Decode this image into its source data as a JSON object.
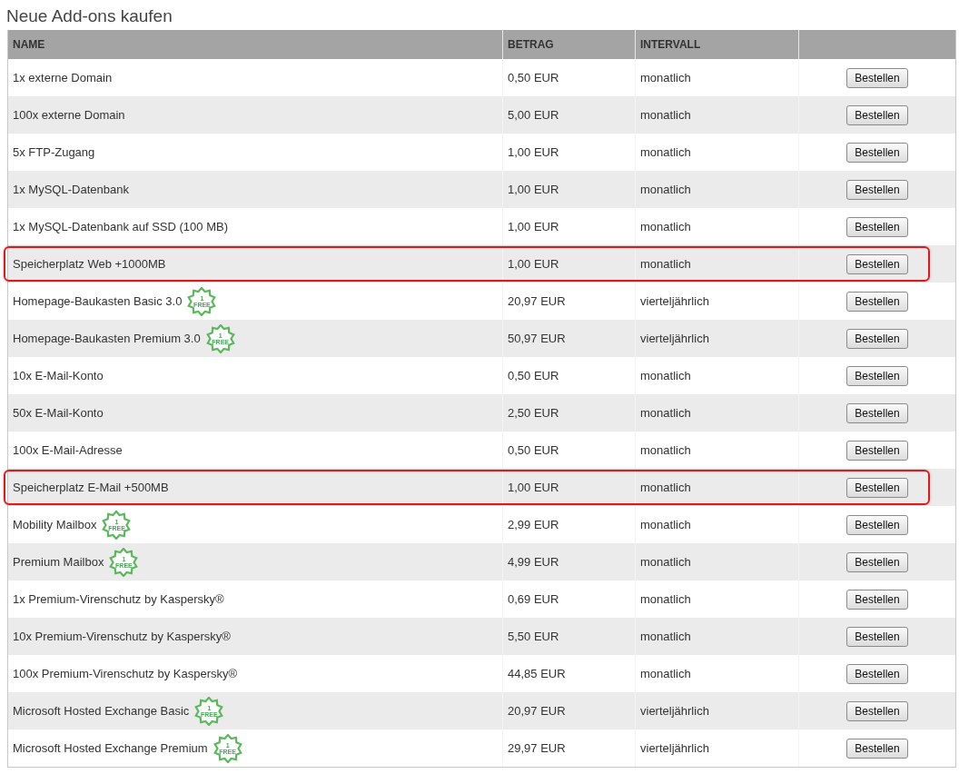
{
  "title": "Neue Add-ons kaufen",
  "columns": [
    "NAME",
    "BETRAG",
    "INTERVALL"
  ],
  "rows": [
    {
      "name": "1x externe Domain",
      "amount": "0,50 EUR",
      "interval": "monatlich",
      "button": "Bestellen",
      "highlighted": false
    },
    {
      "name": "100x externe Domain",
      "amount": "5,00 EUR",
      "interval": "monatlich",
      "button": "Bestellen",
      "highlighted": false
    },
    {
      "name": "5x FTP-Zugang",
      "amount": "1,00 EUR",
      "interval": "monatlich",
      "button": "Bestellen",
      "highlighted": false
    },
    {
      "name": "1x MySQL-Datenbank",
      "amount": "1,00 EUR",
      "interval": "monatlich",
      "button": "Bestellen",
      "highlighted": false
    },
    {
      "name": "1x MySQL-Datenbank auf SSD (100 MB)",
      "amount": "1,00 EUR",
      "interval": "monatlich",
      "button": "Bestellen",
      "highlighted": false
    },
    {
      "name": "Speicherplatz Web +1000MB",
      "amount": "1,00 EUR",
      "interval": "monatlich",
      "button": "Bestellen",
      "highlighted": true
    },
    {
      "name": "Homepage-Baukasten Basic 3.0",
      "badge": [
        "1",
        "FREE"
      ],
      "amount": "20,97 EUR",
      "interval": "vierteljährlich",
      "button": "Bestellen",
      "highlighted": false
    },
    {
      "name": "Homepage-Baukasten Premium 3.0",
      "badge": [
        "1",
        "FREE"
      ],
      "amount": "50,97 EUR",
      "interval": "vierteljährlich",
      "button": "Bestellen",
      "highlighted": false
    },
    {
      "name": "10x E-Mail-Konto",
      "amount": "0,50 EUR",
      "interval": "monatlich",
      "button": "Bestellen",
      "highlighted": false
    },
    {
      "name": "50x E-Mail-Konto",
      "amount": "2,50 EUR",
      "interval": "monatlich",
      "button": "Bestellen",
      "highlighted": false
    },
    {
      "name": "100x E-Mail-Adresse",
      "amount": "0,50 EUR",
      "interval": "monatlich",
      "button": "Bestellen",
      "highlighted": false
    },
    {
      "name": "Speicherplatz E-Mail +500MB",
      "amount": "1,00 EUR",
      "interval": "monatlich",
      "button": "Bestellen",
      "highlighted": true
    },
    {
      "name": "Mobility Mailbox",
      "badge": [
        "1",
        "FREE"
      ],
      "amount": "2,99 EUR",
      "interval": "monatlich",
      "button": "Bestellen",
      "highlighted": false
    },
    {
      "name": "Premium Mailbox",
      "badge": [
        "1",
        "FREE"
      ],
      "amount": "4,99 EUR",
      "interval": "monatlich",
      "button": "Bestellen",
      "highlighted": false
    },
    {
      "name": "1x Premium-Virenschutz by Kaspersky®",
      "amount": "0,69 EUR",
      "interval": "monatlich",
      "button": "Bestellen",
      "highlighted": false
    },
    {
      "name": "10x Premium-Virenschutz by Kaspersky®",
      "amount": "5,50 EUR",
      "interval": "monatlich",
      "button": "Bestellen",
      "highlighted": false
    },
    {
      "name": "100x Premium-Virenschutz by Kaspersky®",
      "amount": "44,85 EUR",
      "interval": "monatlich",
      "button": "Bestellen",
      "highlighted": false
    },
    {
      "name": "Microsoft Hosted Exchange Basic",
      "badge": [
        "1",
        "FREE"
      ],
      "amount": "20,97 EUR",
      "interval": "vierteljährlich",
      "button": "Bestellen",
      "highlighted": false
    },
    {
      "name": "Microsoft Hosted Exchange Premium",
      "badge": [
        "1",
        "FREE"
      ],
      "amount": "29,97 EUR",
      "interval": "vierteljährlich",
      "button": "Bestellen",
      "highlighted": false
    }
  ]
}
